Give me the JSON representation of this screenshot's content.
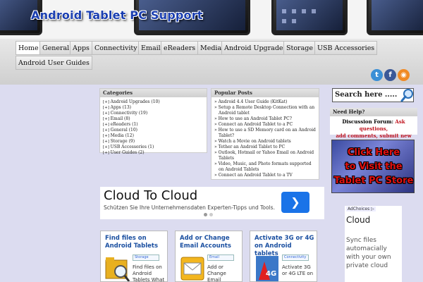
{
  "header": {
    "site_title": "Android Tablet PC Support"
  },
  "nav": {
    "items": [
      "Home",
      "General",
      "Apps",
      "Connectivity",
      "Email",
      "eReaders",
      "Media",
      "Android Upgrades",
      "Storage",
      "USB Accessories",
      "Android User Guides"
    ],
    "active": "Home"
  },
  "social": {
    "icons": [
      "twitter-icon",
      "facebook-icon",
      "rss-icon"
    ],
    "colors": [
      "#3a8fd6",
      "#3b5998",
      "#f08a24"
    ]
  },
  "categories": {
    "heading": "Categories",
    "items": [
      "Android Upgrades (10)",
      "Apps (13)",
      "Connectivity (19)",
      "Email (8)",
      "eReaders (1)",
      "General (10)",
      "Media (12)",
      "Storage (9)",
      "USB Accessories (1)",
      "User Guides (2)"
    ]
  },
  "popular": {
    "heading": "Popular Posts",
    "items": [
      "Android 4.4 User Guide (KitKat)",
      "Setup a Remote Desktop Connection with an Android tablet",
      "How to use an Android Tablet PC?",
      "Connect an Android Tablet to a PC",
      "How to use a SD Memory card on an Android Tablet?",
      "Watch a Movie on Android tablets",
      "Tether an Android Tablet to PC",
      "Outlook, Hotmail or Yahoo Email on Android Tablets",
      "Video, Music, and Photo formats supported on Android Tablets",
      "Connect an Android Tablet to a TV"
    ]
  },
  "search": {
    "placeholder": "Search here ....."
  },
  "help": {
    "heading": "Need Help?",
    "label": "Discussion Forum:",
    "link1": "Ask questions,",
    "link2": "add comments, submit new ideas."
  },
  "store_banner": {
    "line1": "Click Here",
    "line2": "to Visit the",
    "line3": "Tablet PC Store"
  },
  "ad_main": {
    "title": "Cloud To Cloud",
    "subtitle": "Schützen Sie Ihre Unternehmensdaten Experten-Tipps und Tools.",
    "button_glyph": "❯"
  },
  "ad_side": {
    "choices": "AdChoices ▷",
    "title": "Cloud",
    "desc": "Sync files automacially with your own private cloud"
  },
  "cards": [
    {
      "title": "Find files on Android Tablets",
      "tag": "Storage",
      "excerpt": "Find files on Android Tablets What"
    },
    {
      "title": "Add or Change Email Accounts",
      "tag": "Email",
      "excerpt": "Add or Change Email"
    },
    {
      "title": "Activate 3G or 4G on Android tablets",
      "tag": "Connectivity",
      "excerpt": "Activate 3G or 4G LTE on"
    }
  ]
}
